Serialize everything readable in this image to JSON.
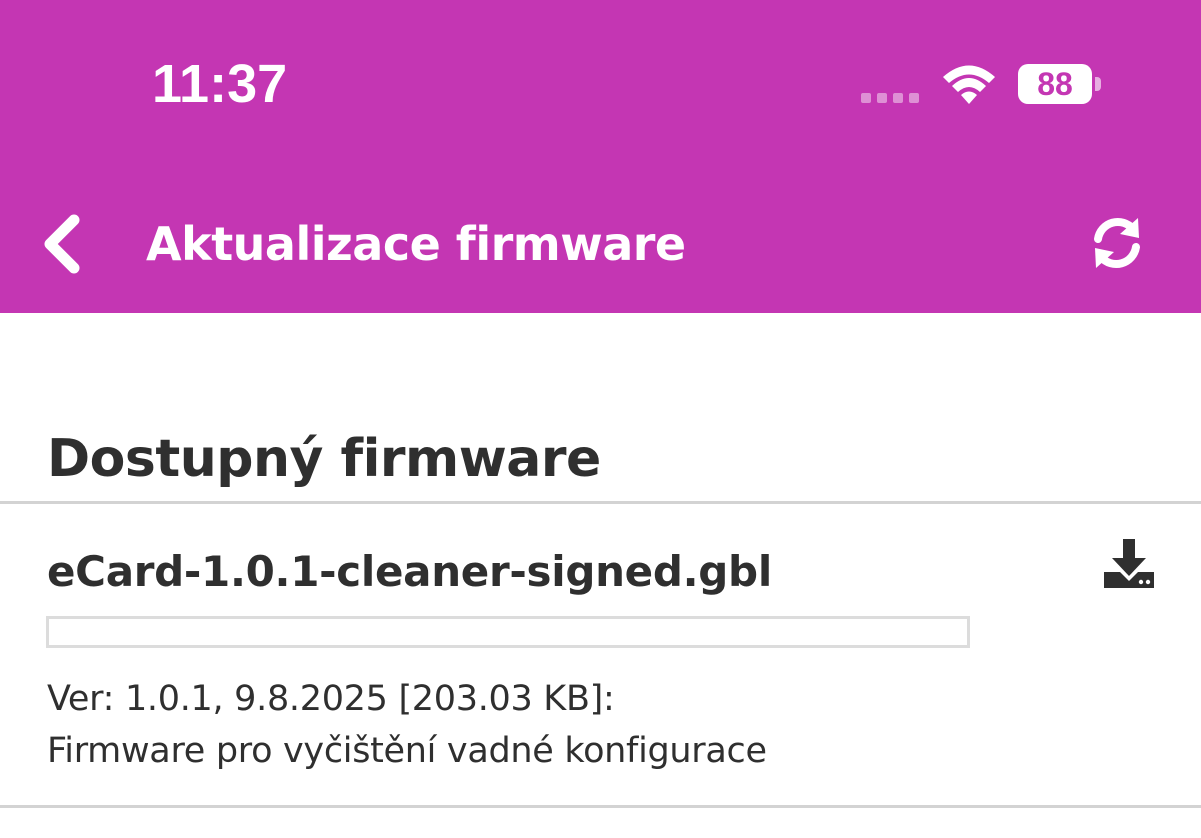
{
  "status_bar": {
    "time": "11:37",
    "battery_level": "88",
    "icons": [
      "signal-icon",
      "wifi-icon",
      "battery-icon"
    ]
  },
  "header": {
    "title": "Aktualizace firmware",
    "back_icon": "chevron-left-icon",
    "refresh_icon": "refresh-icon",
    "background_color": "#c436b3"
  },
  "main": {
    "section_title": "Dostupný firmware",
    "firmware_items": [
      {
        "name": "eCard-1.0.1-cleaner-signed.gbl",
        "meta": "Ver: 1.0.1, 9.8.2025 [203.03 KB]:",
        "description": "Firmware pro vyčištění vadné konfigurace",
        "download_progress": 0,
        "action_icon": "download-icon"
      }
    ]
  }
}
